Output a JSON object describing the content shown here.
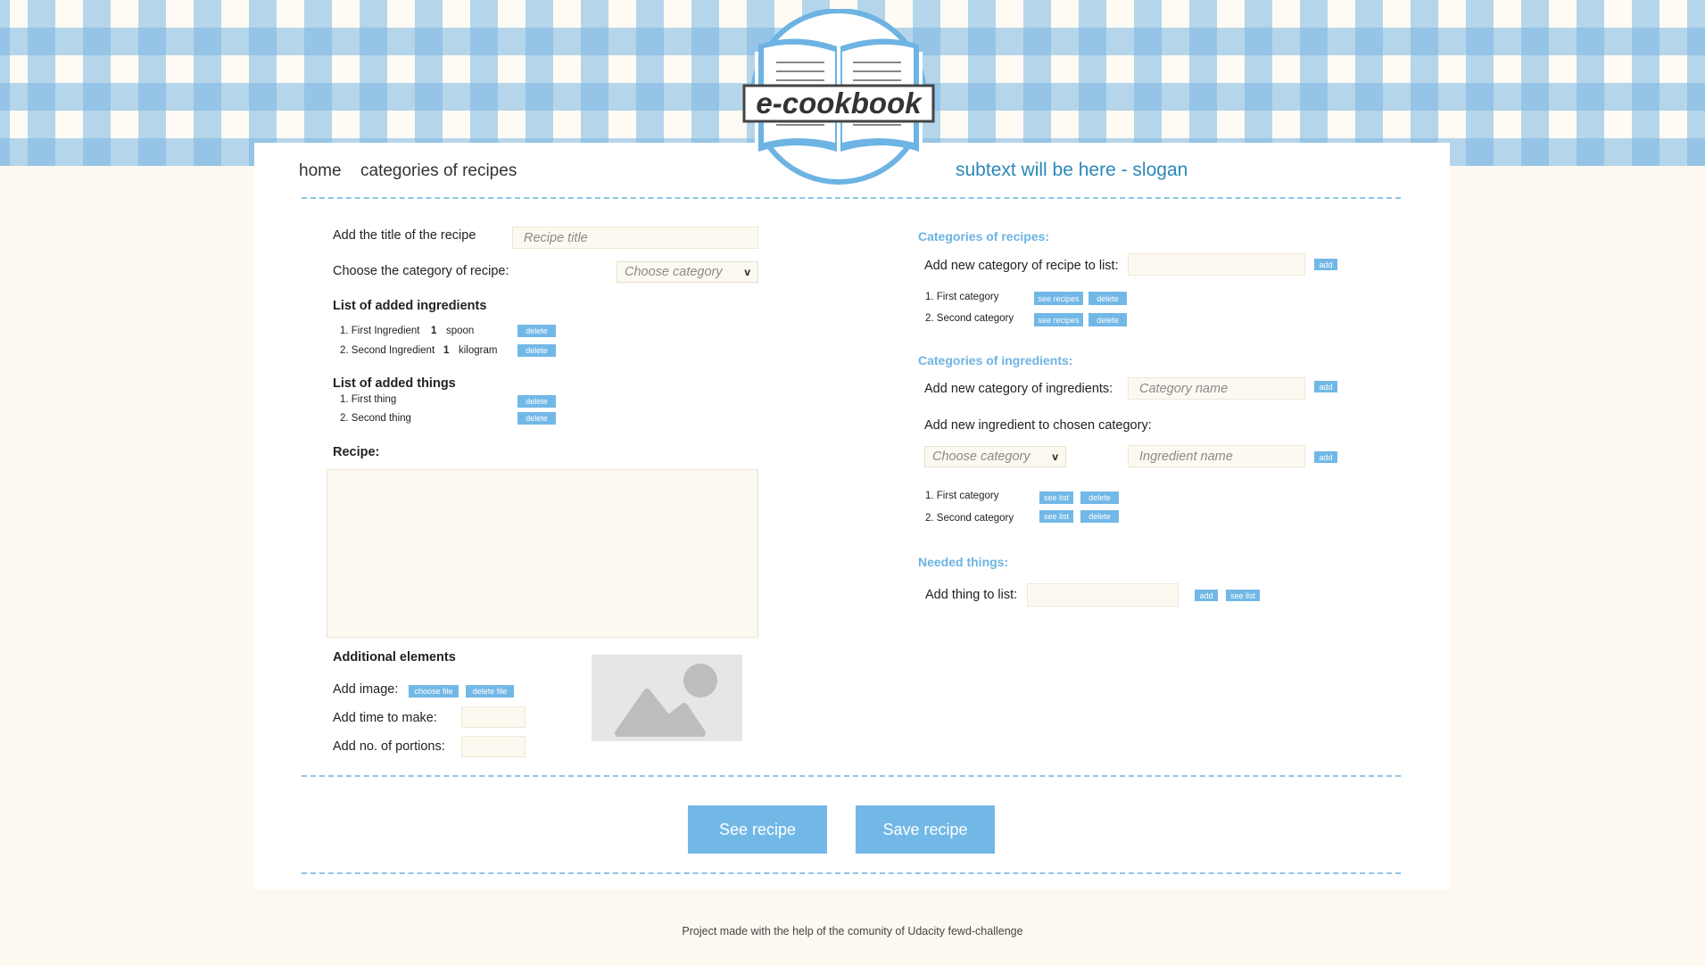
{
  "header": {
    "logo_text": "e-cookbook",
    "nav": {
      "home": "home",
      "categories": "categories of recipes"
    },
    "slogan": "subtext will be here - slogan"
  },
  "recipe_form": {
    "title_label": "Add the title of the recipe",
    "title_placeholder": "Recipe title",
    "category_label": "Choose the category of recipe:",
    "category_select": "Choose category",
    "ingredients_heading": "List of added ingredients",
    "ingredients": [
      {
        "name": "1. First Ingredient",
        "qty": "1",
        "unit": "spoon",
        "delete": "delete"
      },
      {
        "name": "2. Second Ingredient",
        "qty": "1",
        "unit": "kilogram",
        "delete": "delete"
      }
    ],
    "things_heading": "List of added things",
    "things": [
      {
        "name": "1. First thing",
        "delete": "delete"
      },
      {
        "name": "2. Second thing",
        "delete": "delete"
      }
    ],
    "recipe_label": "Recipe:",
    "additional_heading": "Additional elements",
    "add_image_label": "Add image:",
    "choose_file": "choose file",
    "delete_file": "delete file",
    "time_label": "Add time to make:",
    "portions_label": "Add no. of portions:"
  },
  "sidebar": {
    "recipe_categories": {
      "heading": "Categories of recipes:",
      "add_label": "Add new category of recipe to list:",
      "add_button": "add",
      "items": [
        {
          "name": "1. First category",
          "see": "see recipes",
          "delete": "delete"
        },
        {
          "name": "2. Second category",
          "see": "see recipes",
          "delete": "delete"
        }
      ]
    },
    "ingredient_categories": {
      "heading": "Categories of ingredients:",
      "add_label": "Add new category of ingredients:",
      "name_placeholder": "Category name",
      "add_button": "add",
      "new_ingredient_label": "Add new ingredient to chosen category:",
      "category_select": "Choose category",
      "ingredient_placeholder": "Ingredient name",
      "add_ingredient_button": "add",
      "items": [
        {
          "name": "1. First category",
          "see": "see list",
          "delete": "delete"
        },
        {
          "name": "2. Second category",
          "see": "see list",
          "delete": "delete"
        }
      ]
    },
    "needed_things": {
      "heading": "Needed things:",
      "add_label": "Add thing to list:",
      "add_button": "add",
      "see_list_button": "see list"
    }
  },
  "actions": {
    "see_recipe": "See recipe",
    "save_recipe": "Save recipe"
  },
  "footer": {
    "text": "Project made with the help of the comunity of Udacity fewd-challenge"
  },
  "colors": {
    "accent": "#72b8e7",
    "link": "#2a88b8",
    "heading": "#6db3e3",
    "background": "#fdf9f0"
  }
}
